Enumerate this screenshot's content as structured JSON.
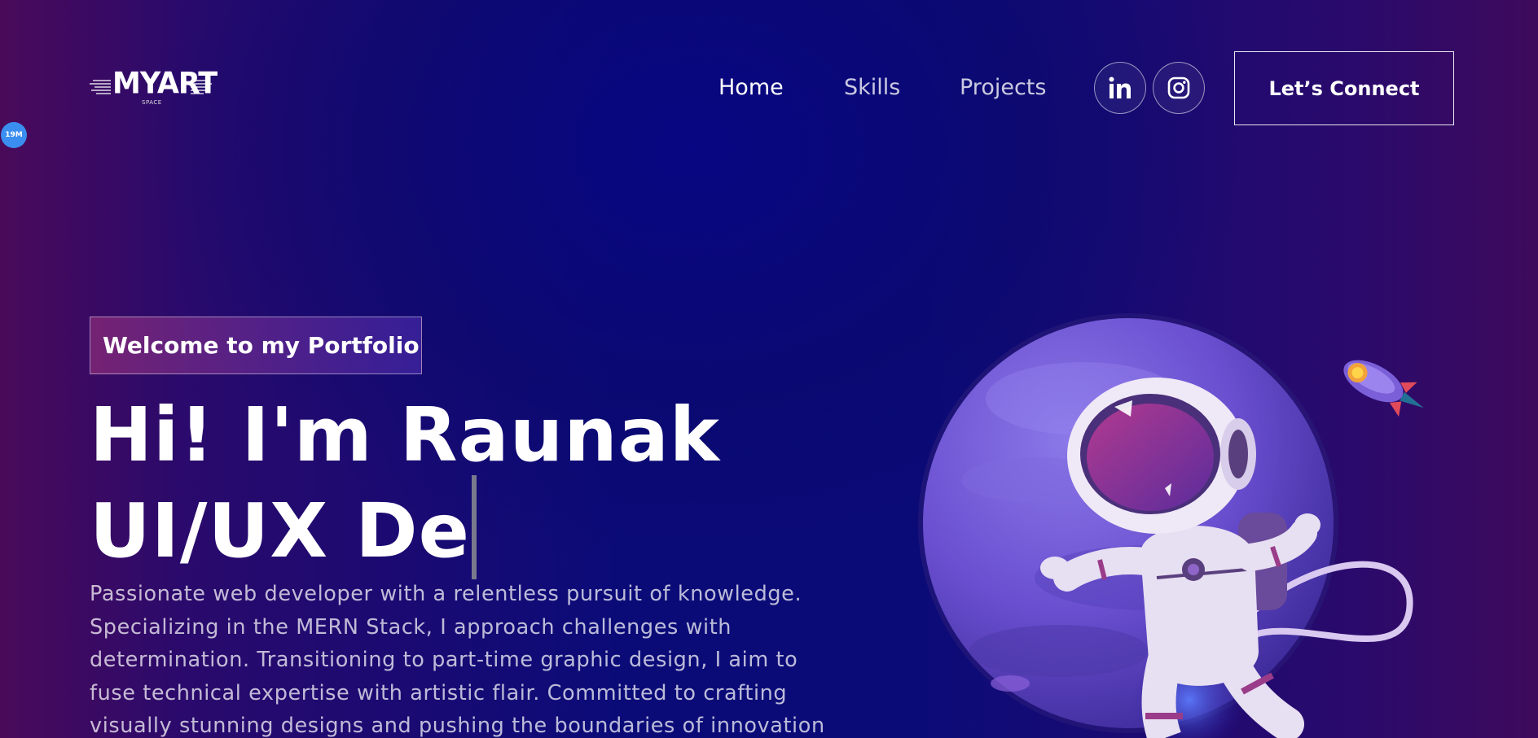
{
  "nav": {
    "logo_text": "MYART",
    "logo_subtext": "SPACE",
    "links": [
      {
        "label": "Home",
        "active": true
      },
      {
        "label": "Skills",
        "active": false
      },
      {
        "label": "Projects",
        "active": false
      }
    ],
    "social": [
      {
        "icon": "linkedin-icon"
      },
      {
        "icon": "instagram-icon"
      }
    ],
    "connect_label": "Let’s Connect"
  },
  "floating_badge": "19M",
  "hero": {
    "tagline": "Welcome to my Portfolio",
    "headline_line1": "Hi! I'm Raunak",
    "headline_line2": "UI/UX De",
    "description": "Passionate web developer with a relentless pursuit of knowledge. Specializing in the MERN Stack, I approach challenges with determination. Transitioning to part-time graphic design, I aim to fuse technical expertise with artistic flair. Committed to crafting visually stunning designs and pushing the boundaries of innovation",
    "illustration": "astronaut-planet-illustration"
  },
  "colors": {
    "background_center": "#0b0b78",
    "background_edge": "#4a0a5a",
    "badge_blue": "#3a8ef0",
    "planet": "#6a4fd0"
  }
}
